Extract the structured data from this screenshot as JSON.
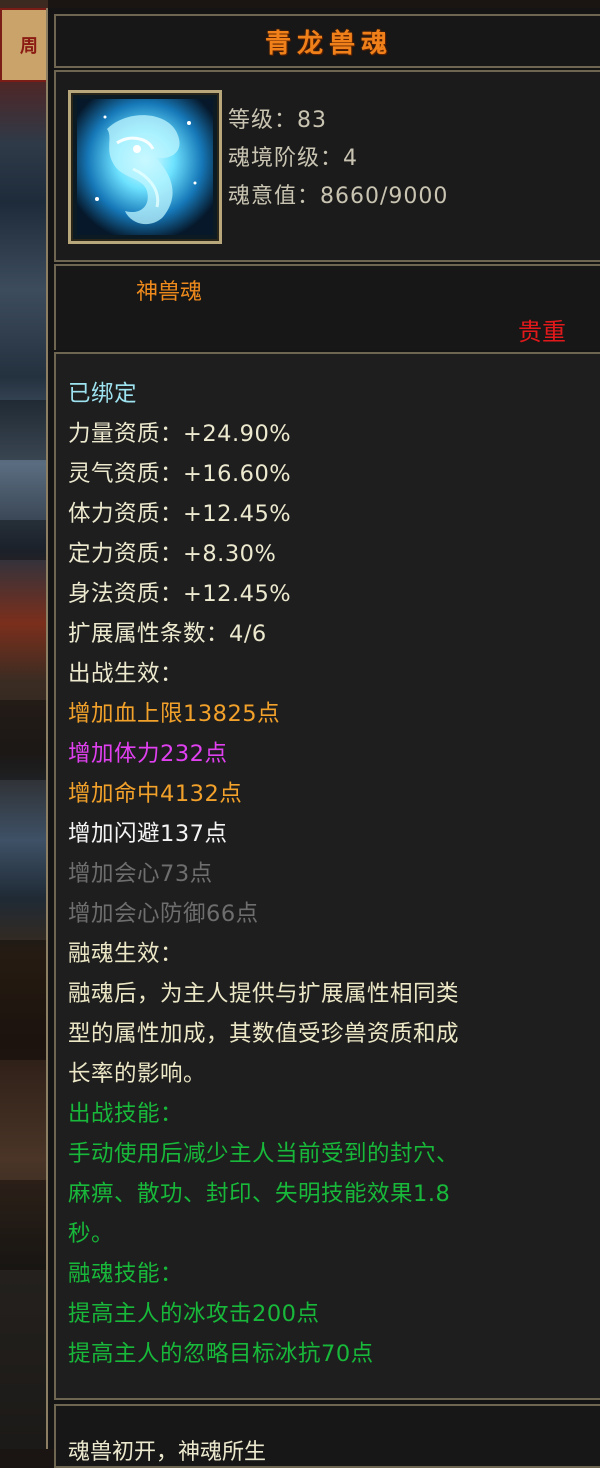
{
  "title": "青龙兽魂",
  "header": {
    "level_label": "等级：",
    "level_value": "83",
    "tier_label": "魂境阶级：",
    "tier_value": "4",
    "soul_label": "魂意值：",
    "soul_value": "8660/9000"
  },
  "type_label": "神兽魂",
  "rarity_label": "贵重",
  "bound_label": "已绑定",
  "attributes": [
    {
      "label": "力量资质：",
      "value": "+24.90%"
    },
    {
      "label": "灵气资质：",
      "value": "+16.60%"
    },
    {
      "label": "体力资质：",
      "value": "+12.45%"
    },
    {
      "label": "定力资质：",
      "value": "+8.30%"
    },
    {
      "label": "身法资质：",
      "value": "+12.45%"
    },
    {
      "label": "扩展属性条数：",
      "value": "4/6"
    }
  ],
  "battle_effect_title": "出战生效：",
  "battle_effects": [
    "增加血上限13825点",
    "增加体力232点",
    "增加命中4132点",
    "增加闪避137点",
    "增加会心73点",
    "增加会心防御66点"
  ],
  "fusion_effect_title": "融魂生效：",
  "fusion_effect_desc": [
    "融魂后，为主人提供与扩展属性相同类",
    "型的属性加成，其数值受珍兽资质和成",
    "长率的影响。"
  ],
  "battle_skill_title": "出战技能：",
  "battle_skill_desc": [
    "手动使用后减少主人当前受到的封穴、",
    "麻痹、散功、封印、失明技能效果1.8",
    "秒。"
  ],
  "fusion_skill_title": "融魂技能：",
  "fusion_skills": [
    "提高主人的冰攻击200点",
    "提高主人的忽略目标冰抗70点"
  ],
  "bottom_text": "魂兽初开，神魂所生",
  "colors": {
    "title": "#f0811a",
    "bound": "#9ee3f0",
    "attr": "#ece9cf",
    "effect_orange": "#f2a12a",
    "effect_magenta": "#e040f0",
    "effect_white": "#f4f4f4",
    "effect_grey": "#6e6e6e",
    "skill_green": "#18b83a",
    "rarity_red": "#e2191b"
  },
  "icons": {
    "item_icon": "azure-dragon-soul-icon"
  }
}
